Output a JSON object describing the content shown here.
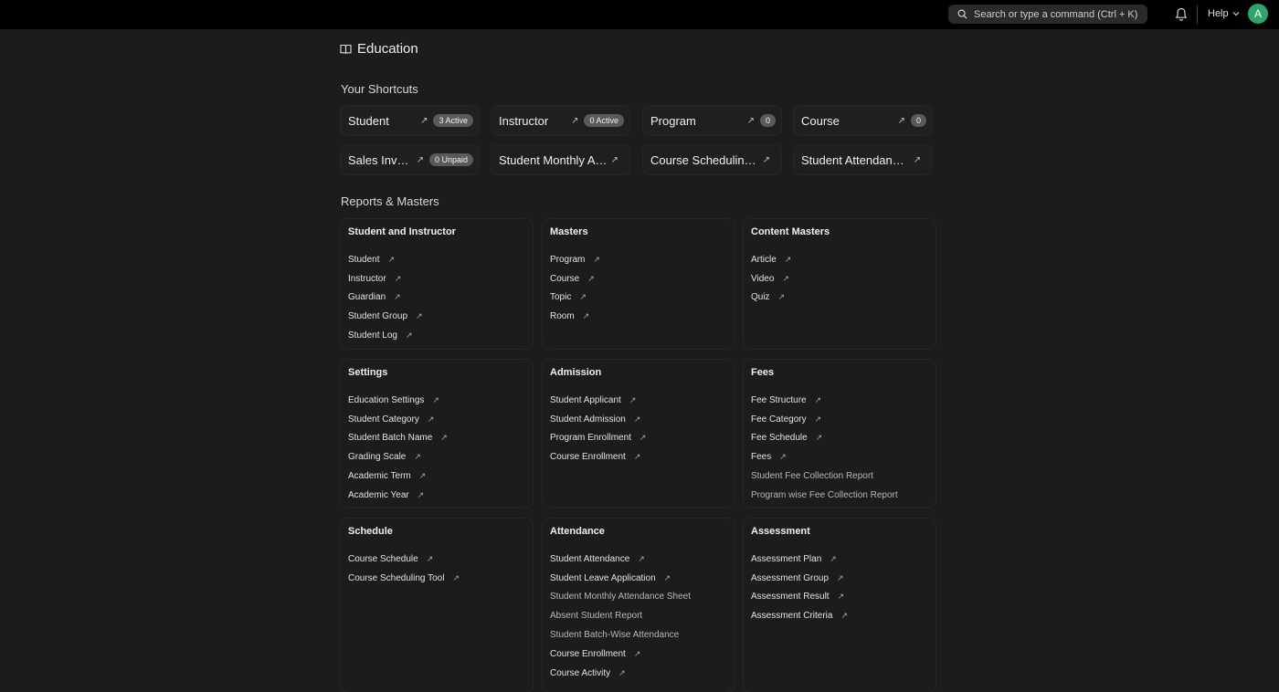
{
  "navbar": {
    "search_placeholder": "Search or type a command (Ctrl + K)",
    "help_label": "Help",
    "avatar_initial": "A"
  },
  "page": {
    "title": "Education"
  },
  "shortcuts": {
    "title": "Your Shortcuts",
    "items": [
      {
        "label": "Student",
        "badge": "3 Active"
      },
      {
        "label": "Instructor",
        "badge": "0 Active"
      },
      {
        "label": "Program",
        "badge": "0"
      },
      {
        "label": "Course",
        "badge": "0"
      },
      {
        "label": "Sales Invoice",
        "badge": "0 Unpaid"
      },
      {
        "label": "Student Monthly Attendance Sheet",
        "badge": ""
      },
      {
        "label": "Course Scheduling Tool",
        "badge": ""
      },
      {
        "label": "Student Attendance Tool",
        "badge": ""
      }
    ]
  },
  "reports": {
    "title": "Reports & Masters",
    "cards": [
      {
        "title": "Student and Instructor",
        "links": [
          "Student",
          "Instructor",
          "Guardian",
          "Student Group",
          "Student Log"
        ]
      },
      {
        "title": "Masters",
        "links": [
          "Program",
          "Course",
          "Topic",
          "Room"
        ]
      },
      {
        "title": "Content Masters",
        "links": [
          "Article",
          "Video",
          "Quiz"
        ]
      },
      {
        "title": "Settings",
        "links": [
          "Education Settings",
          "Student Category",
          "Student Batch Name",
          "Grading Scale",
          "Academic Term",
          "Academic Year"
        ]
      },
      {
        "title": "Admission",
        "links": [
          "Student Applicant",
          "Student Admission",
          "Program Enrollment",
          "Course Enrollment"
        ]
      },
      {
        "title": "Fees",
        "links": [
          "Fee Structure",
          "Fee Category",
          "Fee Schedule",
          "Fees",
          "Student Fee Collection Report",
          "Program wise Fee Collection Report"
        ]
      },
      {
        "title": "Schedule",
        "links": [
          "Course Schedule",
          "Course Scheduling Tool"
        ]
      },
      {
        "title": "Attendance",
        "links": [
          "Student Attendance",
          "Student Leave Application",
          "Student Monthly Attendance Sheet",
          "Absent Student Report",
          "Student Batch-Wise Attendance",
          "Course Enrollment",
          "Course Activity"
        ]
      },
      {
        "title": "Assessment",
        "links": [
          "Assessment Plan",
          "Assessment Group",
          "Assessment Result",
          "Assessment Criteria"
        ]
      }
    ]
  }
}
